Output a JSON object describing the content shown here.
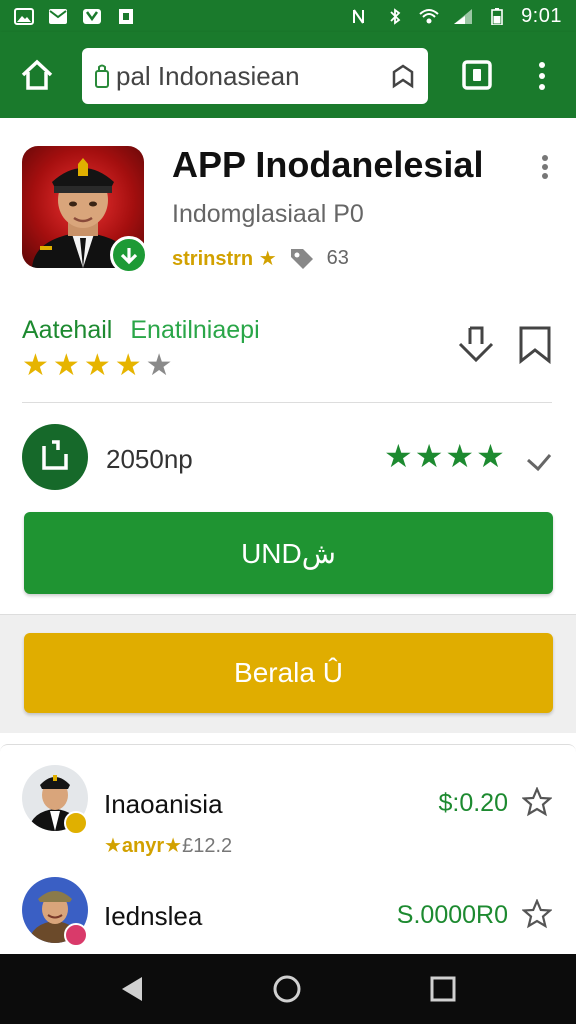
{
  "status_bar": {
    "time": "9:01"
  },
  "browser": {
    "url_text": "pal Indonasiean"
  },
  "app": {
    "title": "APP Inodanelesial",
    "developer": "Indomglasiaal P0",
    "rating_text": "strinstrn",
    "size_text": "63",
    "section_label": "Aatehail",
    "section_sublabel": "Enatilniaepi",
    "rating_stars": 4,
    "installs": "2050np",
    "install_button": "UNDش",
    "buy_button": "Berala Û"
  },
  "list": [
    {
      "name": "Inaoanisia",
      "sub_gold": "★anyr★",
      "sub_grey": "£12.2",
      "price": "$:0.20"
    },
    {
      "name": "Iednslea",
      "price": "S.0000R0"
    }
  ],
  "colors": {
    "primary": "#1a7a2c",
    "install": "#1f9432",
    "accent_gold": "#e0ad00"
  }
}
